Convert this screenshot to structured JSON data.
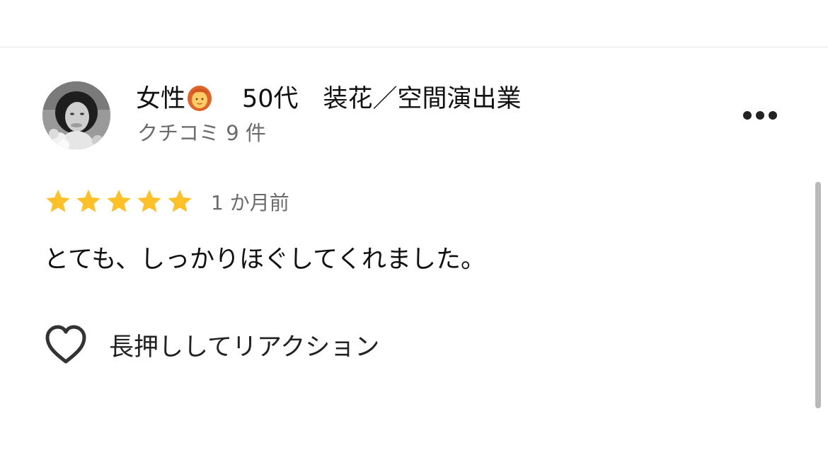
{
  "reviewer": {
    "name_prefix": "女性",
    "name_emoji_icon": "woman-red-hair-emoji",
    "name_details": "50代　装花／空間演出業",
    "review_count": "クチコミ 9 件",
    "avatar_icon": "reviewer-photo"
  },
  "more_menu": {
    "icon": "more-horizontal-icon"
  },
  "rating": {
    "stars": 5,
    "max_stars": 5,
    "star_color": "#FFC028",
    "timestamp": "1 か月前"
  },
  "review": {
    "text": "とても、しっかりほぐしてくれました。"
  },
  "reaction": {
    "icon": "heart-outline-icon",
    "label": "長押ししてリアクション"
  },
  "colors": {
    "text_primary": "#111111",
    "text_secondary": "#6B6B6B",
    "divider": "#E4E4E4",
    "scrollbar": "#B9B9B9"
  }
}
